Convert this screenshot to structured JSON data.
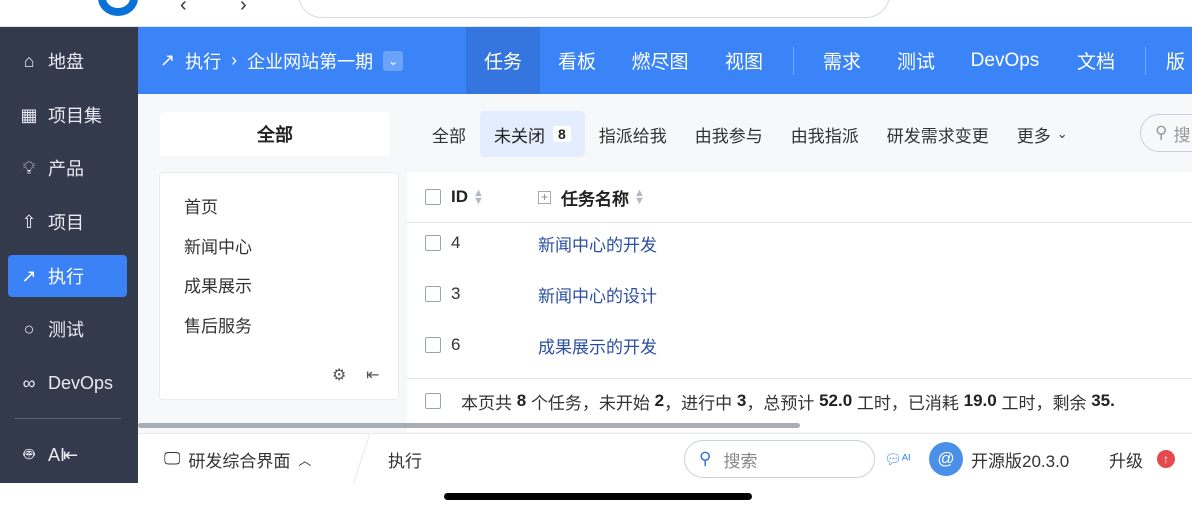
{
  "sidebar": {
    "items": [
      {
        "label": "地盘",
        "icon": "home-icon"
      },
      {
        "label": "项目集",
        "icon": "grid-icon"
      },
      {
        "label": "产品",
        "icon": "bulb-icon"
      },
      {
        "label": "项目",
        "icon": "rocket-icon"
      },
      {
        "label": "执行",
        "icon": "run-icon",
        "active": true
      },
      {
        "label": "测试",
        "icon": "search-icon"
      },
      {
        "label": "DevOps",
        "icon": "infinity-icon"
      },
      {
        "label": "AI",
        "icon": "robot-icon"
      }
    ]
  },
  "header": {
    "module": "执行",
    "project": "企业网站第一期",
    "nav": [
      "任务",
      "看板",
      "燃尽图",
      "视图",
      "需求",
      "测试",
      "DevOps",
      "文档",
      "版"
    ]
  },
  "left_panel": {
    "title": "全部",
    "tree": [
      "首页",
      "新闻中心",
      "成果展示",
      "售后服务"
    ]
  },
  "tabs": [
    {
      "label": "全部"
    },
    {
      "label": "未关闭",
      "count": "8"
    },
    {
      "label": "指派给我"
    },
    {
      "label": "由我参与"
    },
    {
      "label": "由我指派"
    },
    {
      "label": "研发需求变更"
    },
    {
      "label": "更多"
    }
  ],
  "search_placeholder": "搜",
  "table": {
    "columns": [
      "ID",
      "任务名称"
    ],
    "rows": [
      {
        "id": "4",
        "name": "新闻中心的开发"
      },
      {
        "id": "3",
        "name": "新闻中心的设计"
      },
      {
        "id": "6",
        "name": "成果展示的开发"
      }
    ],
    "summary": {
      "t1": "本页共",
      "total": "8",
      "t2": "个任务，未开始",
      "not_started": "2",
      "t3": "，进行中",
      "in_progress": "3",
      "t4": "，总预计",
      "estimate": "52.0",
      "t5": "工时，已消耗",
      "consumed": "19.0",
      "t6": "工时，剩余",
      "left": "35."
    }
  },
  "bottom": {
    "workspace": "研发综合界面",
    "current": "执行",
    "search": "搜索",
    "version": "开源版20.3.0",
    "upgrade": "升级"
  },
  "colors": {
    "accent": "#3b84f8",
    "sidebar": "#323a4b"
  }
}
